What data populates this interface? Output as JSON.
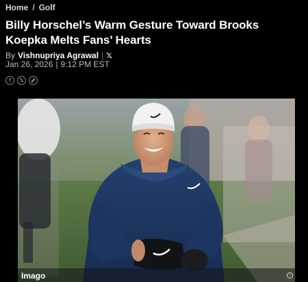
{
  "breadcrumb": {
    "home": "Home",
    "separator": "/",
    "section": "Golf"
  },
  "article": {
    "title": "Billy Horschel’s Warm Gesture Toward Brooks Koepka Melts Fans’ Hearts",
    "by_label": "By",
    "author": "Vishnupriya Agrawal",
    "divider": "|",
    "x_label": "𝕏",
    "date": "Jan 26, 2026",
    "date_divider": "|",
    "time": "9:12 PM EST"
  },
  "share": {
    "facebook": "f",
    "x": "𝕏",
    "link": "🔗"
  },
  "image": {
    "caption": "Imago",
    "info": "i"
  },
  "colors": {
    "background": "#000000",
    "text": "#ffffff",
    "muted": "#bdbdbd"
  }
}
